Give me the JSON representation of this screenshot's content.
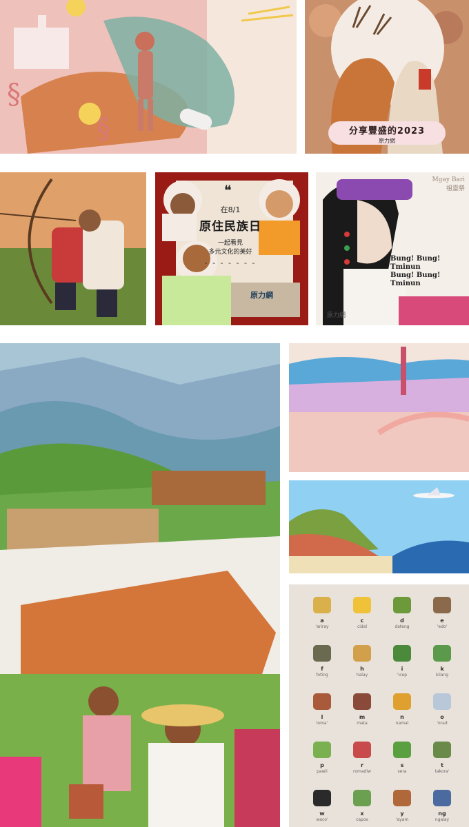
{
  "gallery": {
    "deer": {
      "title": "分享豐盛的2023",
      "logo": "原力網"
    },
    "indigenous_day": {
      "quote": "❝",
      "date": "在8/1",
      "headline": "原住民族日",
      "sub1": "一起看見",
      "sub2": "多元文化的美好",
      "dashes": "- - - - - - -",
      "logo": "原力網"
    },
    "weaver": {
      "artist_latin": "Mgay Bari",
      "artist_zh": "祖靈祭",
      "chant_line1": "Bung! Bung! Tminun",
      "chant_line2": "Bung! Bung! Tminun",
      "logo": "原力網"
    },
    "alphabet": [
      {
        "letter": "a",
        "word": "'ariray",
        "color": "#d9b04a"
      },
      {
        "letter": "c",
        "word": "cidal",
        "color": "#f0c23a"
      },
      {
        "letter": "d",
        "word": "dateng",
        "color": "#6c9a3a"
      },
      {
        "letter": "e",
        "word": "'edo'",
        "color": "#8a6a4a"
      },
      {
        "letter": "f",
        "word": "foting",
        "color": "#6a6a50"
      },
      {
        "letter": "h",
        "word": "halay",
        "color": "#d2a04a"
      },
      {
        "letter": "i",
        "word": "'icep",
        "color": "#4a8a3a"
      },
      {
        "letter": "k",
        "word": "kilang",
        "color": "#5a9a4a"
      },
      {
        "letter": "l",
        "word": "loma'",
        "color": "#a85a3a"
      },
      {
        "letter": "m",
        "word": "mata",
        "color": "#8a4a3a"
      },
      {
        "letter": "n",
        "word": "namal",
        "color": "#e0a030"
      },
      {
        "letter": "o",
        "word": "'orad",
        "color": "#b8c8d8"
      },
      {
        "letter": "p",
        "word": "pawli",
        "color": "#7ab050"
      },
      {
        "letter": "r",
        "word": "romadiw",
        "color": "#c84a4a"
      },
      {
        "letter": "s",
        "word": "sera",
        "color": "#5aa040"
      },
      {
        "letter": "t",
        "word": "takora'",
        "color": "#6a8a4a"
      },
      {
        "letter": "w",
        "word": "waco'",
        "color": "#2a2a2a"
      },
      {
        "letter": "x",
        "word": "capox",
        "color": "#6aa050"
      },
      {
        "letter": "y",
        "word": "'ayam",
        "color": "#b0683a"
      },
      {
        "letter": "ng",
        "word": "ngalay",
        "color": "#4a6aa0"
      }
    ]
  }
}
